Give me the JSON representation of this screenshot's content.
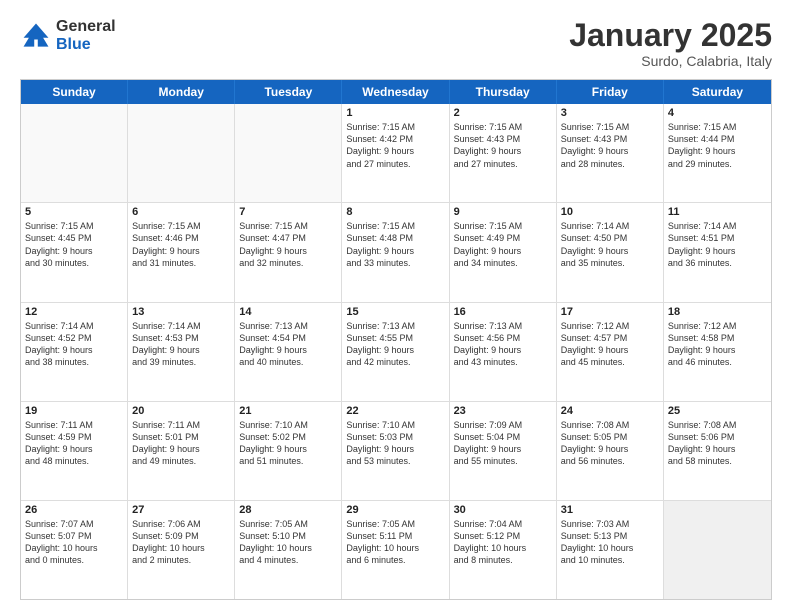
{
  "logo": {
    "general": "General",
    "blue": "Blue"
  },
  "header": {
    "month": "January 2025",
    "location": "Surdo, Calabria, Italy"
  },
  "weekdays": [
    "Sunday",
    "Monday",
    "Tuesday",
    "Wednesday",
    "Thursday",
    "Friday",
    "Saturday"
  ],
  "rows": [
    [
      {
        "day": "",
        "info": "",
        "empty": true
      },
      {
        "day": "",
        "info": "",
        "empty": true
      },
      {
        "day": "",
        "info": "",
        "empty": true
      },
      {
        "day": "1",
        "info": "Sunrise: 7:15 AM\nSunset: 4:42 PM\nDaylight: 9 hours\nand 27 minutes."
      },
      {
        "day": "2",
        "info": "Sunrise: 7:15 AM\nSunset: 4:43 PM\nDaylight: 9 hours\nand 27 minutes."
      },
      {
        "day": "3",
        "info": "Sunrise: 7:15 AM\nSunset: 4:43 PM\nDaylight: 9 hours\nand 28 minutes."
      },
      {
        "day": "4",
        "info": "Sunrise: 7:15 AM\nSunset: 4:44 PM\nDaylight: 9 hours\nand 29 minutes."
      }
    ],
    [
      {
        "day": "5",
        "info": "Sunrise: 7:15 AM\nSunset: 4:45 PM\nDaylight: 9 hours\nand 30 minutes."
      },
      {
        "day": "6",
        "info": "Sunrise: 7:15 AM\nSunset: 4:46 PM\nDaylight: 9 hours\nand 31 minutes."
      },
      {
        "day": "7",
        "info": "Sunrise: 7:15 AM\nSunset: 4:47 PM\nDaylight: 9 hours\nand 32 minutes."
      },
      {
        "day": "8",
        "info": "Sunrise: 7:15 AM\nSunset: 4:48 PM\nDaylight: 9 hours\nand 33 minutes."
      },
      {
        "day": "9",
        "info": "Sunrise: 7:15 AM\nSunset: 4:49 PM\nDaylight: 9 hours\nand 34 minutes."
      },
      {
        "day": "10",
        "info": "Sunrise: 7:14 AM\nSunset: 4:50 PM\nDaylight: 9 hours\nand 35 minutes."
      },
      {
        "day": "11",
        "info": "Sunrise: 7:14 AM\nSunset: 4:51 PM\nDaylight: 9 hours\nand 36 minutes."
      }
    ],
    [
      {
        "day": "12",
        "info": "Sunrise: 7:14 AM\nSunset: 4:52 PM\nDaylight: 9 hours\nand 38 minutes."
      },
      {
        "day": "13",
        "info": "Sunrise: 7:14 AM\nSunset: 4:53 PM\nDaylight: 9 hours\nand 39 minutes."
      },
      {
        "day": "14",
        "info": "Sunrise: 7:13 AM\nSunset: 4:54 PM\nDaylight: 9 hours\nand 40 minutes."
      },
      {
        "day": "15",
        "info": "Sunrise: 7:13 AM\nSunset: 4:55 PM\nDaylight: 9 hours\nand 42 minutes."
      },
      {
        "day": "16",
        "info": "Sunrise: 7:13 AM\nSunset: 4:56 PM\nDaylight: 9 hours\nand 43 minutes."
      },
      {
        "day": "17",
        "info": "Sunrise: 7:12 AM\nSunset: 4:57 PM\nDaylight: 9 hours\nand 45 minutes."
      },
      {
        "day": "18",
        "info": "Sunrise: 7:12 AM\nSunset: 4:58 PM\nDaylight: 9 hours\nand 46 minutes."
      }
    ],
    [
      {
        "day": "19",
        "info": "Sunrise: 7:11 AM\nSunset: 4:59 PM\nDaylight: 9 hours\nand 48 minutes."
      },
      {
        "day": "20",
        "info": "Sunrise: 7:11 AM\nSunset: 5:01 PM\nDaylight: 9 hours\nand 49 minutes."
      },
      {
        "day": "21",
        "info": "Sunrise: 7:10 AM\nSunset: 5:02 PM\nDaylight: 9 hours\nand 51 minutes."
      },
      {
        "day": "22",
        "info": "Sunrise: 7:10 AM\nSunset: 5:03 PM\nDaylight: 9 hours\nand 53 minutes."
      },
      {
        "day": "23",
        "info": "Sunrise: 7:09 AM\nSunset: 5:04 PM\nDaylight: 9 hours\nand 55 minutes."
      },
      {
        "day": "24",
        "info": "Sunrise: 7:08 AM\nSunset: 5:05 PM\nDaylight: 9 hours\nand 56 minutes."
      },
      {
        "day": "25",
        "info": "Sunrise: 7:08 AM\nSunset: 5:06 PM\nDaylight: 9 hours\nand 58 minutes."
      }
    ],
    [
      {
        "day": "26",
        "info": "Sunrise: 7:07 AM\nSunset: 5:07 PM\nDaylight: 10 hours\nand 0 minutes."
      },
      {
        "day": "27",
        "info": "Sunrise: 7:06 AM\nSunset: 5:09 PM\nDaylight: 10 hours\nand 2 minutes."
      },
      {
        "day": "28",
        "info": "Sunrise: 7:05 AM\nSunset: 5:10 PM\nDaylight: 10 hours\nand 4 minutes."
      },
      {
        "day": "29",
        "info": "Sunrise: 7:05 AM\nSunset: 5:11 PM\nDaylight: 10 hours\nand 6 minutes."
      },
      {
        "day": "30",
        "info": "Sunrise: 7:04 AM\nSunset: 5:12 PM\nDaylight: 10 hours\nand 8 minutes."
      },
      {
        "day": "31",
        "info": "Sunrise: 7:03 AM\nSunset: 5:13 PM\nDaylight: 10 hours\nand 10 minutes."
      },
      {
        "day": "",
        "info": "",
        "empty": true,
        "shaded": true
      }
    ]
  ]
}
